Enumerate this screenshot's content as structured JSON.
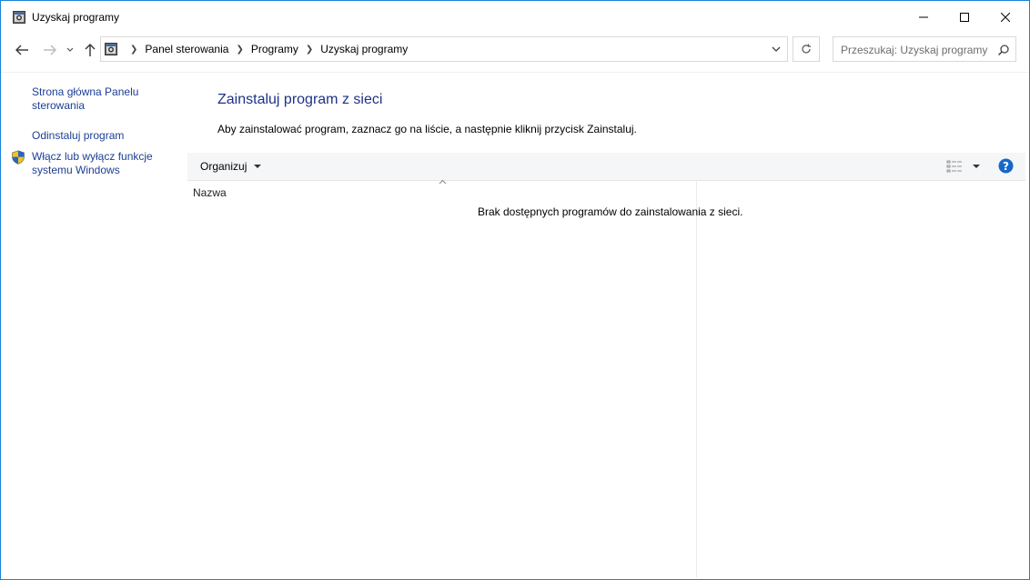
{
  "window": {
    "title": "Uzyskaj programy",
    "icon": "control-panel-icon",
    "controls": [
      "minimize-icon",
      "maximize-icon",
      "close-icon"
    ]
  },
  "nav": {
    "back": "back-arrow-icon",
    "forward": "forward-arrow-icon",
    "recent": "chevron-down-icon",
    "up": "up-arrow-icon"
  },
  "address": {
    "crumbs": [
      "Panel sterowania",
      "Programy",
      "Uzyskaj programy"
    ]
  },
  "search": {
    "placeholder": "Przeszukaj: Uzyskaj programy"
  },
  "sidebar": {
    "items": [
      {
        "label": "Strona główna Panelu sterowania"
      },
      {
        "label": "Odinstaluj program"
      },
      {
        "label": "Włącz lub wyłącz funkcje systemu Windows",
        "icon": "shield-icon"
      }
    ]
  },
  "main": {
    "heading": "Zainstaluj program z sieci",
    "instruction": "Aby zainstalować program, zaznacz go na liście, a następnie kliknij przycisk Zainstaluj.",
    "toolbar": {
      "organize_label": "Organizuj"
    },
    "list": {
      "column_name": "Nazwa",
      "empty_message": "Brak dostępnych programów do zainstalowania z sieci."
    }
  },
  "colors": {
    "border": "#1883d7",
    "heading": "#1e3287",
    "link": "#1c3f94",
    "help": "#1668c8"
  }
}
